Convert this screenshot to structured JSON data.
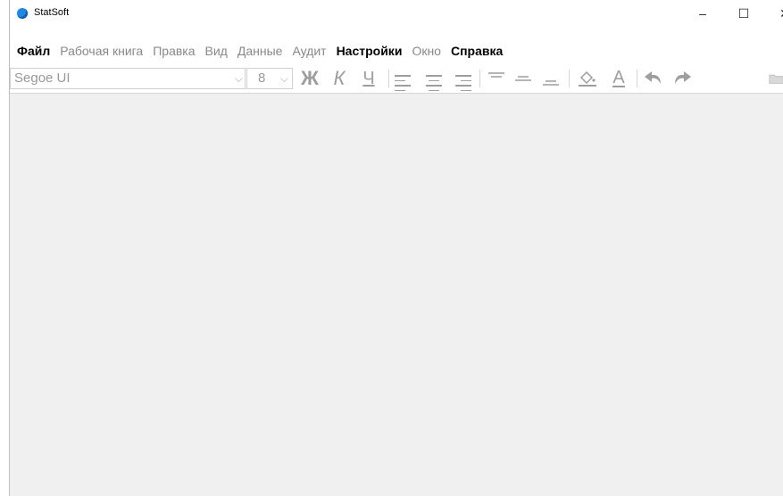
{
  "window": {
    "title": "StatSoft",
    "controls": {
      "minimize": "–",
      "maximize": "☐",
      "close": "✕"
    }
  },
  "menu": [
    {
      "label": "Файл",
      "enabled": true
    },
    {
      "label": "Рабочая книга",
      "enabled": false
    },
    {
      "label": "Правка",
      "enabled": false
    },
    {
      "label": "Вид",
      "enabled": false
    },
    {
      "label": "Данные",
      "enabled": false
    },
    {
      "label": "Аудит",
      "enabled": false
    },
    {
      "label": "Настройки",
      "enabled": true
    },
    {
      "label": "Окно",
      "enabled": false
    },
    {
      "label": "Справка",
      "enabled": true
    }
  ],
  "toolbar": {
    "font_name": "Segoe UI",
    "font_size": "8",
    "bold_label": "Ж",
    "italic_label": "К",
    "underline_label": "Ч",
    "font_color_label": "A"
  },
  "colors": {
    "accent": "#1e88e5",
    "disabled": "#9e9e9e",
    "workspace": "#f0f0f0"
  }
}
